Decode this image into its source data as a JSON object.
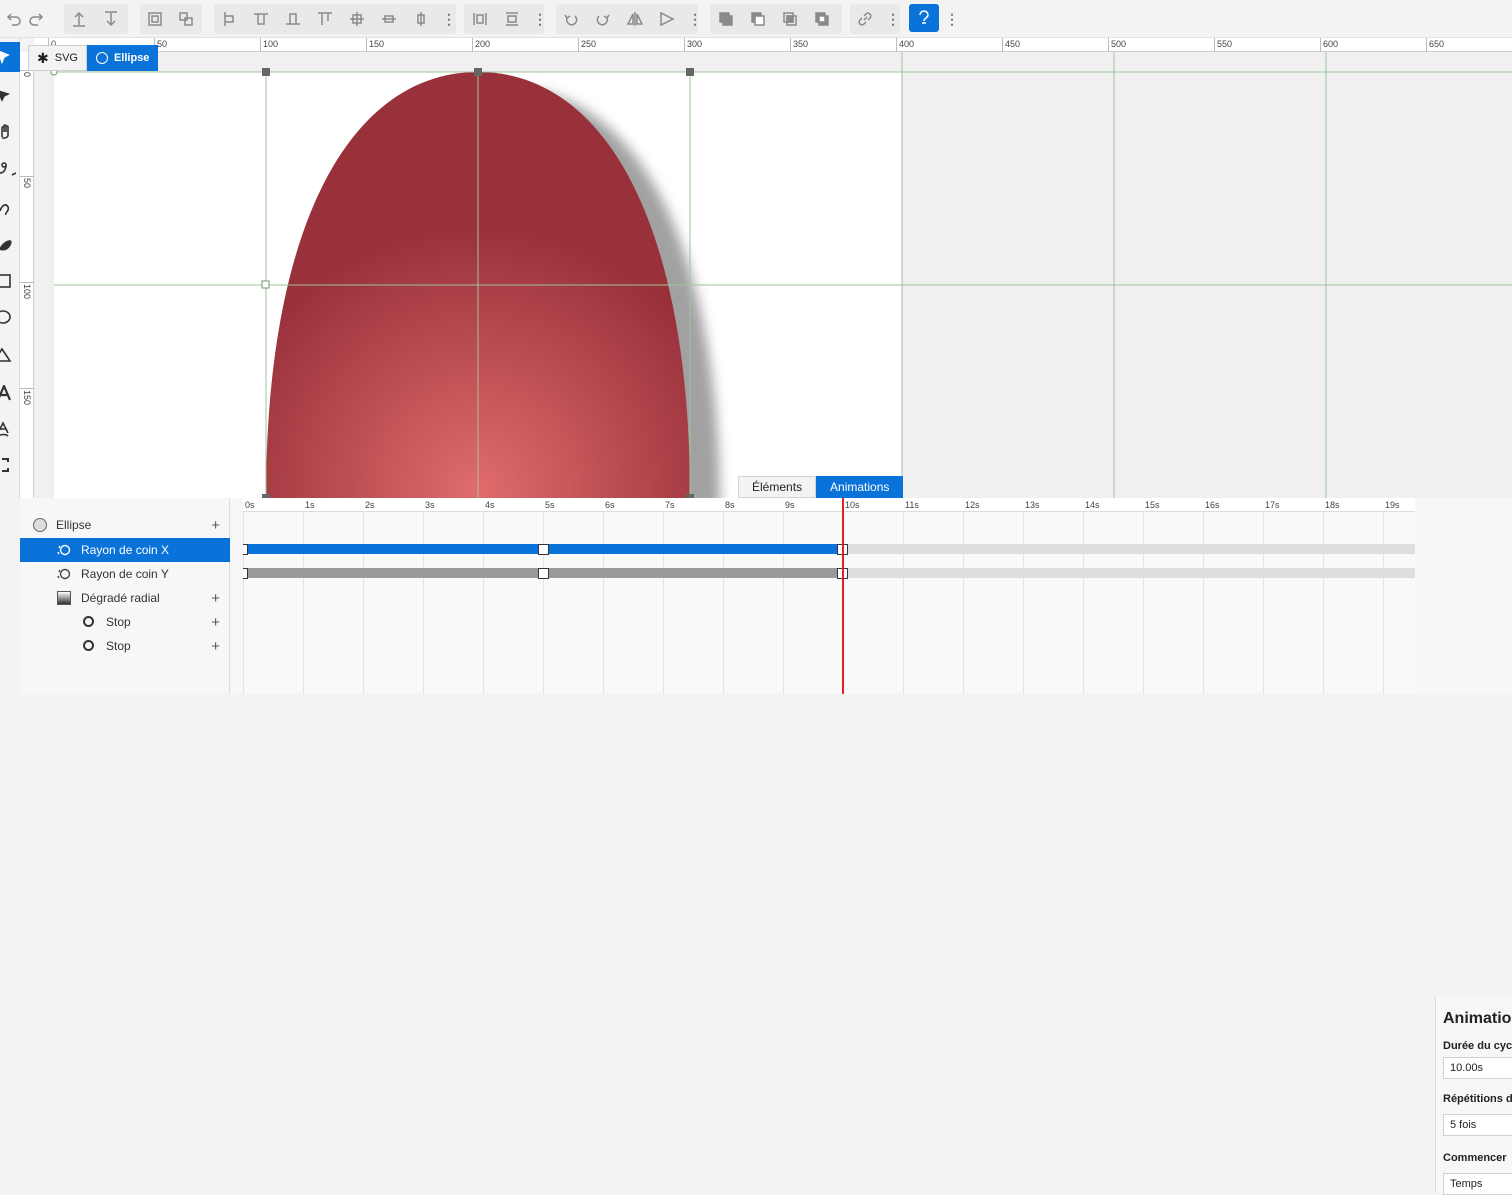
{
  "toolbar": {
    "icons": [
      "undo-icon",
      "redo-icon",
      "move-up-layer-icon",
      "move-down-layer-icon",
      "group-icon",
      "ungroup-icon",
      "align-left-icon",
      "align-top-icon",
      "align-bottom-icon",
      "align-top-edge-icon",
      "align-center-icon",
      "align-middle-h-icon",
      "align-middle-v-icon",
      "distribute-h-icon",
      "distribute-v-icon",
      "rotate-left-icon",
      "rotate-right-icon",
      "flip-h-icon",
      "flip-v-icon",
      "union-icon",
      "subtract-icon",
      "intersect-icon",
      "exclude-icon",
      "link-icon",
      "snap-icon"
    ],
    "accent": "#0a73d9"
  },
  "breadcrumb": {
    "items": [
      {
        "label": "SVG",
        "icon": "asterisk-icon"
      },
      {
        "label": "Ellipse",
        "icon": "circle-icon"
      }
    ]
  },
  "ruler": {
    "top": [
      "0",
      "50",
      "100",
      "150",
      "200",
      "250",
      "300",
      "350",
      "400",
      "450",
      "500",
      "550",
      "600",
      "650"
    ],
    "left": [
      "0",
      "50",
      "100",
      "150"
    ]
  },
  "canvas": {
    "shape_fill": "#99313b",
    "shape_highlight": "#e06c6c",
    "guide_color": "#9dc49a"
  },
  "tabs": {
    "elements": "Éléments",
    "animations": "Animations"
  },
  "layers": [
    {
      "label": "Ellipse",
      "icon": "circle-icon",
      "plus": "+"
    },
    {
      "label": "Rayon de coin X",
      "icon": "animation-icon",
      "selected": true
    },
    {
      "label": "Rayon de coin Y",
      "icon": "animation-icon"
    },
    {
      "label": "Dégradé radial",
      "icon": "gradient-icon",
      "plus": "+"
    },
    {
      "label": "Stop",
      "icon": "stop-icon",
      "plus": "+"
    },
    {
      "label": "Stop",
      "icon": "stop-icon",
      "plus": "+"
    }
  ],
  "timeline": {
    "labels": [
      "0s",
      "1s",
      "2s",
      "3s",
      "4s",
      "5s",
      "6s",
      "7s",
      "8s",
      "9s",
      "10s",
      "11s",
      "12s",
      "13s",
      "14s",
      "15s",
      "16s",
      "17s",
      "18s",
      "19s"
    ],
    "playhead": "10s",
    "track_color": "#0a73d9",
    "track_inactive": "#9a9a9a",
    "playhead_color": "#e0202a"
  },
  "props": {
    "title": "Animation",
    "cycle_label": "Durée du cycle",
    "cycle_value": "10.00s",
    "repeat_label": "Répétitions du c",
    "repeat_value": "5 fois",
    "start_label": "Commencer",
    "start_value": "Temps"
  }
}
